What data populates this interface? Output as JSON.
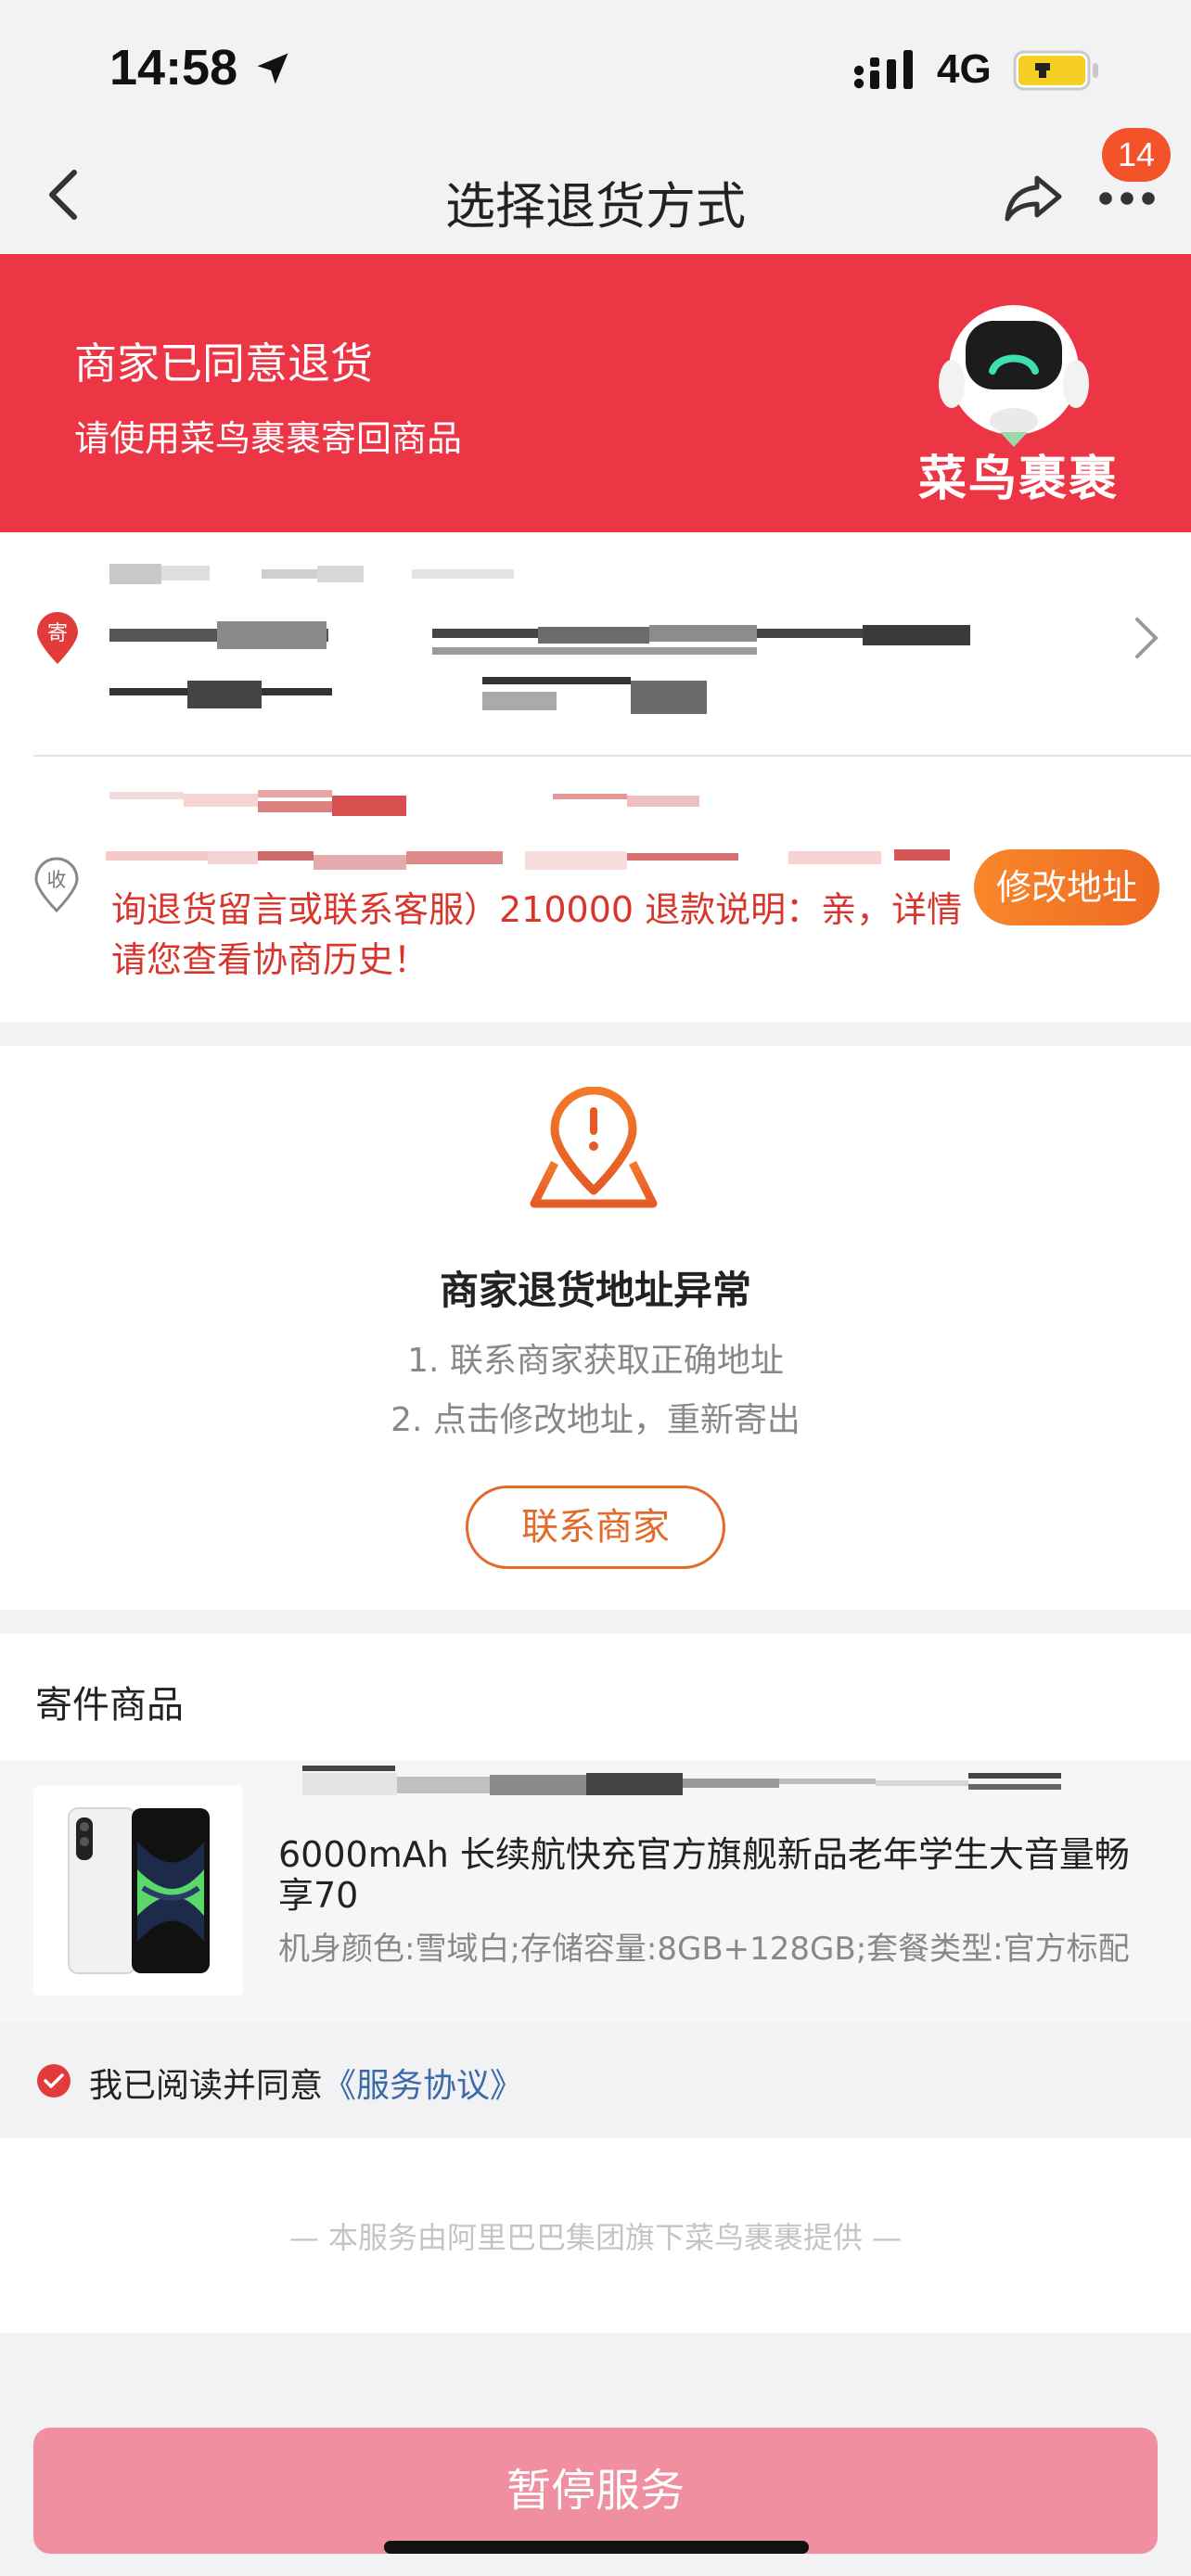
{
  "status_bar": {
    "time": "14:58",
    "network": "4G",
    "icons": [
      "location-arrow-icon",
      "signal-icon",
      "battery-icon"
    ]
  },
  "nav": {
    "title": "选择退货方式",
    "badge_count": "14",
    "icons": [
      "back-arrow-icon",
      "share-icon",
      "more-icon"
    ]
  },
  "banner": {
    "title": "商家已同意退货",
    "subtitle": "请使用菜鸟裹裹寄回商品",
    "brand": "菜鸟裹裹",
    "color": "#ec3646"
  },
  "address": {
    "sender_tag": "寄",
    "receiver_tag": "收",
    "receiver_note": "询退货留言或联系客服）210000 退款说明：亲，详情请您查看协商历史！",
    "edit_button": "修改地址"
  },
  "anomaly": {
    "title": "商家退货地址异常",
    "tips": [
      "1. 联系商家获取正确地址",
      "2. 点击修改地址，重新寄出"
    ],
    "contact_button": "联系商家",
    "accent_color": "#e26a2b"
  },
  "goods": {
    "section_title": "寄件商品",
    "name": "6000mAh 长续航快充官方旗舰新品老年学生大音量畅享70",
    "spec": "机身颜色:雪域白;存储容量:8GB+128GB;套餐类型:官方标配"
  },
  "agreement": {
    "prefix": "我已阅读并同意",
    "link": "《服务协议》"
  },
  "footer": {
    "provider": "—    本服务由阿里巴巴集团旗下菜鸟裹裹提供    —",
    "pause_button": "暂停服务"
  }
}
